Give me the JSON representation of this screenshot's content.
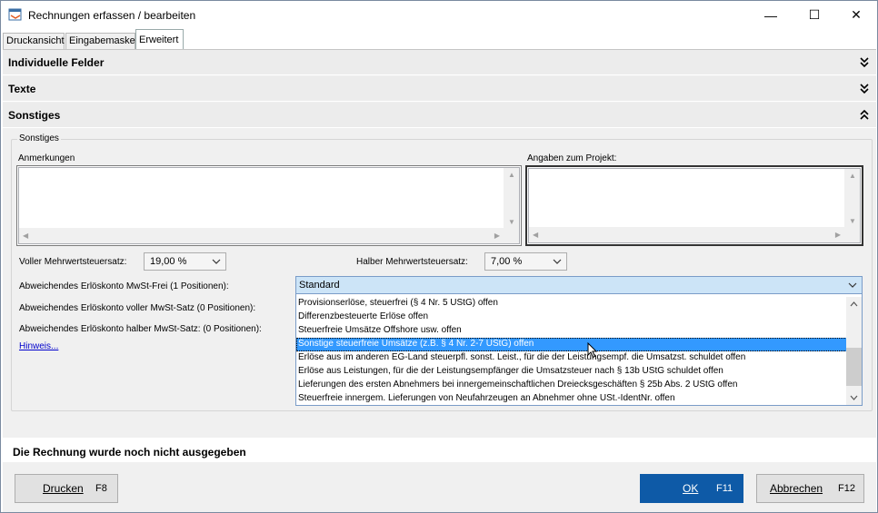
{
  "window": {
    "title": "Rechnungen erfassen / bearbeiten",
    "minimize": "—",
    "maximize": "☐",
    "close": "✕"
  },
  "tabs": [
    {
      "label": "Druckansicht",
      "active": false
    },
    {
      "label": "Eingabemaske",
      "active": false
    },
    {
      "label": "Erweitert",
      "active": true
    }
  ],
  "sections": [
    {
      "label": "Individuelle Felder",
      "state": "collapsed"
    },
    {
      "label": "Texte",
      "state": "collapsed"
    },
    {
      "label": "Sonstiges",
      "state": "expanded"
    }
  ],
  "sonstiges": {
    "group_title": "Sonstiges",
    "anmerkungen_label": "Anmerkungen",
    "anmerkungen_value": "",
    "projekt_label": "Angaben zum Projekt:",
    "projekt_value": "",
    "voller_label": "Voller Mehrwertsteuersatz:",
    "voller_value": "19,00 %",
    "halber_label": "Halber Mehrwertsteuersatz:",
    "halber_value": "7,00 %",
    "mwst_frei_label": "Abweichendes Erlöskonto MwSt-Frei (1 Positionen):",
    "voller_konto_label": "Abweichendes Erlöskonto voller MwSt-Satz (0 Positionen):",
    "halber_konto_label": "Abweichendes Erlöskonto halber MwSt-Satz: (0 Positionen):",
    "hinweis_link": "Hinweis...",
    "dropdown_selected": "Standard",
    "dropdown_options": [
      "Provisionserlöse, steuerfrei (§ 4 Nr. 5 UStG) offen",
      "Differenzbesteuerte Erlöse offen",
      "Steuerfreie Umsätze Offshore usw. offen",
      "Sonstige steuerfreie Umsätze (z.B. § 4 Nr. 2-7 UStG) offen",
      "Erlöse aus im anderen EG-Land steuerpfl. sonst. Leist., für die der Leistungsempf. die Umsatzst. schuldet offen",
      "Erlöse aus Leistungen, für die der Leistungsempfänger die Umsatzsteuer nach § 13b UStG schuldet offen",
      "Lieferungen des ersten Abnehmers bei innergemeinschaftlichen Dreiecksgeschäften § 25b Abs. 2 UStG offen",
      "Steuerfreie innergem. Lieferungen von Neufahrzeugen an Abnehmer ohne USt.-IdentNr. offen"
    ],
    "highlighted_option_index": 3
  },
  "status": {
    "message": "Die Rechnung wurde noch nicht ausgegeben"
  },
  "buttons": {
    "drucken": "Drucken",
    "drucken_key": "F8",
    "ok": "OK",
    "ok_key": "F11",
    "abbrechen": "Abbrechen",
    "abbrechen_key": "F12"
  },
  "colors": {
    "primary_button": "#0e5aa7",
    "selection": "#3399ff",
    "link": "#0000cc"
  }
}
